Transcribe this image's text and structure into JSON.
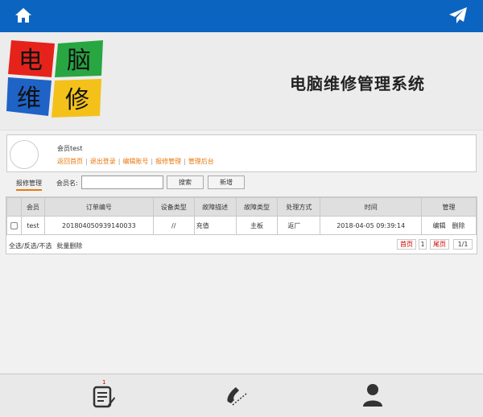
{
  "topbar": {
    "home_icon": "home-icon",
    "send_icon": "paper-plane-icon",
    "color": "#0b64bf"
  },
  "header": {
    "logo_chars": [
      "电",
      "脑",
      "维",
      "修"
    ],
    "system_title": "电脑维修管理系统"
  },
  "member": {
    "name": "会员test",
    "links": [
      "返回首页",
      "退出登录",
      "编辑账号",
      "报修管理",
      "管理后台"
    ]
  },
  "toolbar": {
    "tab_label": "报修管理",
    "field_label": "会员名:",
    "search_value": "",
    "search_button": "搜索",
    "add_button": "新增"
  },
  "table": {
    "columns": [
      "",
      "会员",
      "订单编号",
      "设备类型",
      "故障描述",
      "故障类型",
      "处理方式",
      "时间",
      "管理"
    ],
    "rows": [
      {
        "member": "test",
        "order_no": "20180405093914003​3",
        "device_type": "//",
        "fault_desc": "充值",
        "fault_type": "主板",
        "handling": "返厂",
        "time": "2018-04-05 09:39:14",
        "edit": "编辑",
        "delete": "删除"
      }
    ]
  },
  "footer": {
    "select_ops": "全选/反选/不选",
    "batch_delete": "批量删除",
    "first_page": "首页",
    "page_num": "1",
    "last_page": "尾页",
    "page_info": "1/1"
  },
  "bottombar": {
    "items": [
      "orders-icon",
      "phone-icon",
      "user-icon"
    ],
    "badge": "1"
  }
}
